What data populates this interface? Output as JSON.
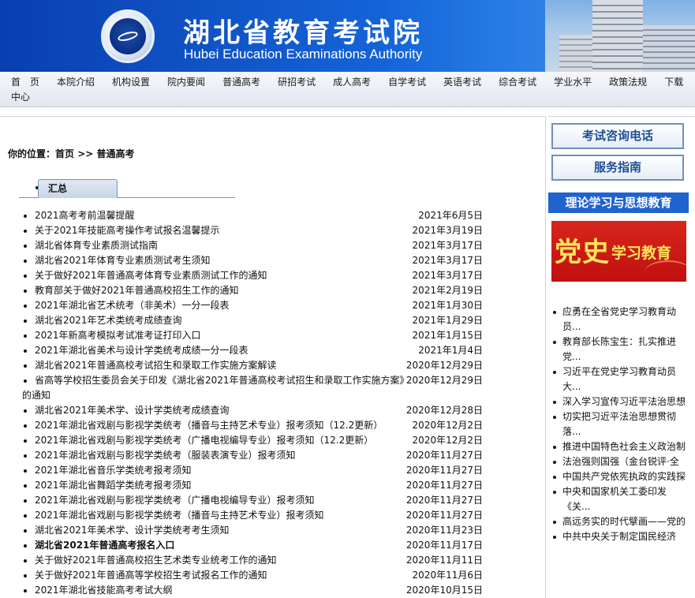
{
  "header": {
    "title_cn": "湖北省教育考试院",
    "title_en": "Hubei Education Examinations Authority"
  },
  "nav": {
    "items": [
      "首　页",
      "本院介绍",
      "机构设置",
      "院内要闻",
      "普通高考",
      "研招考试",
      "成人高考",
      "自学考试",
      "英语考试",
      "综合考试",
      "学业水平",
      "政策法规",
      "下载中心"
    ]
  },
  "breadcrumb": {
    "label": "你的位置：",
    "home": "首页",
    "sep": " >> ",
    "current": "普通高考"
  },
  "tab": {
    "label": "汇总"
  },
  "news": [
    {
      "title": "2021高考考前温馨提醒",
      "date": "2021年6月5日"
    },
    {
      "title": "关于2021年技能高考操作考试报名温馨提示",
      "date": "2021年3月19日"
    },
    {
      "title": "湖北省体育专业素质测试指南",
      "date": "2021年3月17日"
    },
    {
      "title": "湖北省2021年体育专业素质测试考生须知",
      "date": "2021年3月17日"
    },
    {
      "title": "关于做好2021年普通高考体育专业素质测试工作的通知",
      "date": "2021年3月17日"
    },
    {
      "title": "教育部关于做好2021年普通高校招生工作的通知",
      "date": "2021年2月19日"
    },
    {
      "title": "2021年湖北省艺术统考（非美术）一分一段表",
      "date": "2021年1月30日"
    },
    {
      "title": "湖北省2021年艺术类统考成绩查询",
      "date": "2021年1月29日"
    },
    {
      "title": "2021年新高考模拟考试准考证打印入口",
      "date": "2021年1月15日"
    },
    {
      "title": "2021年湖北省美术与设计学类统考成绩一分一段表",
      "date": "2021年1月4日"
    },
    {
      "title": "湖北省2021年普通高校考试招生和录取工作实施方案解读",
      "date": "2020年12月29日"
    },
    {
      "title": "省高等学校招生委员会关于印发《湖北省2021年普通高校考试招生和录取工作实施方案》",
      "title_cont": "的通知",
      "date": "2020年12月29日"
    },
    {
      "title": "湖北省2021年美术学、设计学类统考成绩查询",
      "date": "2020年12月28日"
    },
    {
      "title": "2021年湖北省戏剧与影视学类统考（播音与主持艺术专业）报考须知（12.2更新）",
      "date": "2020年12月2日"
    },
    {
      "title": "2021年湖北省戏剧与影视学类统考（广播电视编导专业）报考须知（12.2更新）",
      "date": "2020年12月2日"
    },
    {
      "title": "2021年湖北省戏剧与影视学类统考（服装表演专业）报考须知",
      "date": "2020年11月27日"
    },
    {
      "title": "2021年湖北省音乐学类统考报考须知",
      "date": "2020年11月27日"
    },
    {
      "title": "2021年湖北省舞蹈学类统考报考须知",
      "date": "2020年11月27日"
    },
    {
      "title": "2021年湖北省戏剧与影视学类统考（广播电视编导专业）报考须知",
      "date": "2020年11月27日"
    },
    {
      "title": "2021年湖北省戏剧与影视学类统考（播音与主持艺术专业）报考须知",
      "date": "2020年11月27日"
    },
    {
      "title": "湖北省2021年美术学、设计学类统考考生须知",
      "date": "2020年11月23日"
    },
    {
      "title": "湖北省2021年普通高考报名入口",
      "date": "2020年11月17日",
      "bold": true
    },
    {
      "title": "关于做好2021年普通高校招生艺术类专业统考工作的通知",
      "date": "2020年11月11日"
    },
    {
      "title": "关于做好2021年普通高等学校招生考试报名工作的通知",
      "date": "2020年11月6日"
    },
    {
      "title": "2021年湖北省技能高考考试大纲",
      "date": "2020年10月15日"
    }
  ],
  "sidebar": {
    "hotline": "考试咨询电话",
    "guide": "服务指南",
    "theory_title": "理论学习与思想教育",
    "party_big": "党史",
    "party_small": "学习教育",
    "items": [
      "应勇在全省党史学习教育动员...",
      "教育部长陈宝生：扎实推进党...",
      "习近平在党史学习教育动员大...",
      "深入学习宣传习近平法治思想",
      "切实把习近平法治思想贯彻落...",
      "推进中国特色社会主义政治制",
      "法治强则国强（金台锐评·全",
      "中国共产党依宪执政的实践探",
      "中央和国家机关工委印发《关...",
      "高远务实的时代擘画——党的",
      "中共中央关于制定国民经济"
    ]
  }
}
